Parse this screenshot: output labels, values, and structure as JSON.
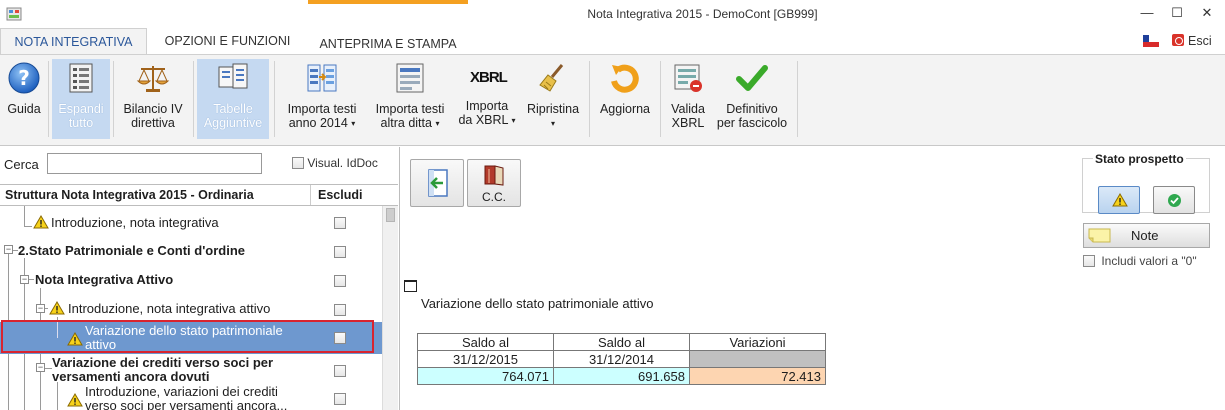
{
  "window": {
    "title": "Nota Integrativa 2015 - DemoCont [GB999]",
    "minimize_glyph": "—",
    "maximize_glyph": "☐",
    "close_glyph": "✕"
  },
  "tabs": [
    {
      "label": "NOTA INTEGRATIVA",
      "active": true
    },
    {
      "label": "OPZIONI E FUNZIONI",
      "active": false
    },
    {
      "label": "ANTEPRIMA E STAMPA",
      "active": false
    }
  ],
  "esci_label": "Esci",
  "ribbon": {
    "guida": "Guida",
    "espandi_1": "Espandi",
    "espandi_2": "tutto",
    "bilancio_1": "Bilancio IV",
    "bilancio_2": "direttiva",
    "tabelle_1": "Tabelle",
    "tabelle_2": "Aggiuntive",
    "importa_testi_1": "Importa testi",
    "importa_testi_2": "anno 2014",
    "importa_altra_1": "Importa testi",
    "importa_altra_2": "altra ditta",
    "importa_xbrl_1": "Importa",
    "importa_xbrl_2": "da XBRL",
    "ripristina": "Ripristina",
    "aggiorna": "Aggiorna",
    "valida_1": "Valida",
    "valida_2": "XBRL",
    "definitivo_1": "Definitivo",
    "definitivo_2": "per fascicolo",
    "xbrl_logo": "XBRL",
    "caret": "▾"
  },
  "search": {
    "label": "Cerca",
    "value": "",
    "visual_label": "Visual. IdDoc"
  },
  "tree": {
    "header_title": "Struttura Nota Integrativa 2015 - Ordinaria",
    "header_escludi": "Escludi",
    "rows": [
      {
        "text": "Introduzione, nota integrativa"
      },
      {
        "text": "2.Stato Patrimoniale e Conti d'ordine"
      },
      {
        "text": "Nota Integrativa Attivo"
      },
      {
        "text": "Introduzione, nota integrativa attivo"
      },
      {
        "text_1": "Variazione dello stato patrimoniale",
        "text_2": "attivo"
      },
      {
        "text_1": "Variazione dei crediti verso soci per",
        "text_2": "versamenti ancora dovuti"
      },
      {
        "text_1": "Introduzione, variazioni dei crediti",
        "text_2": "verso soci per versamenti ancora..."
      }
    ]
  },
  "main": {
    "cc_label": "C.C.",
    "stato_title": "Stato prospetto",
    "note_label": "Note",
    "includi_label": "Includi valori a \"0\"",
    "section_title": "Variazione dello stato patrimoniale attivo",
    "table": {
      "h1": "Saldo al",
      "h2": "Saldo al",
      "h3": "Variazioni",
      "d1": "31/12/2015",
      "d2": "31/12/2014",
      "v1": "764.071",
      "v2": "691.658",
      "v3": "72.413"
    }
  },
  "colors": {
    "accent_tab": "#f4a021",
    "selection": "#6e98cf",
    "highlight_outline": "#d9242f",
    "cyan_cell": "#ccffff",
    "peach_cell": "#fdd5b1"
  }
}
